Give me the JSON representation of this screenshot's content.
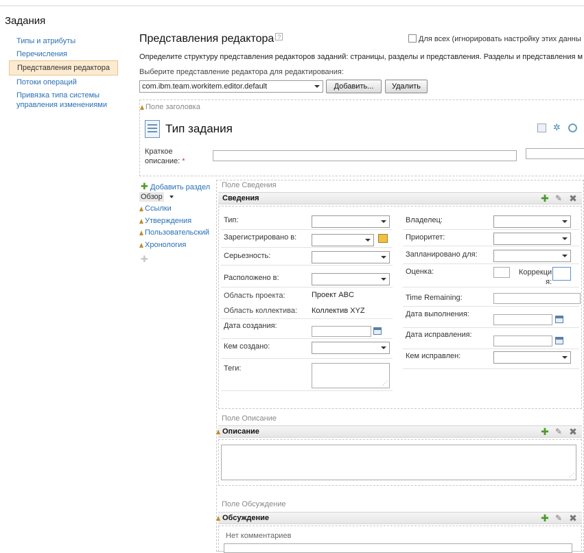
{
  "page": {
    "title": "Задания"
  },
  "nav": {
    "items": [
      {
        "label": "Типы и атрибуты"
      },
      {
        "label": "Перечисления"
      },
      {
        "label": "Представления редактора",
        "active": true
      },
      {
        "label": "Потоки операций"
      },
      {
        "label": "Привязка типа системы",
        "label2": "управления изменениями"
      }
    ]
  },
  "header": {
    "title": "Представления редактора",
    "help_icon": "?",
    "checkbox_label": "Для всех (игнорировать настройку этих данны",
    "description": "Определите структуру представления редакторов заданий: страницы, разделы и представления. Разделы и представления м",
    "choose_label": "Выберите представление редактора для редактирования:",
    "editor_select": "com.ibm.team.workitem.editor.default",
    "add_button": "Добавить...",
    "delete_button": "Удалить"
  },
  "header_area": {
    "label": "Поле заголовка",
    "task_title": "Тип задания",
    "short_desc_label": "Краткое",
    "short_desc_label2": "описание:",
    "required_mark": "*"
  },
  "sections_nav": {
    "add_section": "Добавить раздел",
    "overview": "Обзор",
    "items": [
      {
        "label": "Ссылки"
      },
      {
        "label": "Утверждения"
      },
      {
        "label": "Пользовательский"
      },
      {
        "label": "Хронология"
      }
    ]
  },
  "details": {
    "area_label": "Поле Сведения",
    "title": "Сведения",
    "left_fields": {
      "type": "Тип:",
      "filed_in": "Зарегистрировано в:",
      "severity": "Серьезность:",
      "found_in": "Расположено в:",
      "project_area": "Область проекта:",
      "project_area_value": "Проект ABC",
      "team_area": "Область коллектива:",
      "team_area_value": "Коллектив XYZ",
      "created": "Дата создания:",
      "created_by": "Кем создано:",
      "tags": "Теги:"
    },
    "right_fields": {
      "owner": "Владелец:",
      "priority": "Приоритет:",
      "planned_for": "Запланировано для:",
      "estimate": "Оценка:",
      "correction": "Коррекци",
      "correction2": "я:",
      "time_remaining": "Time Remaining:",
      "due_date": "Дата выполнения:",
      "resolved_date": "Дата исправления:",
      "resolved_by": "Кем исправлен:"
    }
  },
  "description": {
    "area_label": "Поле Описание",
    "title": "Описание"
  },
  "discussion": {
    "area_label": "Поле Обсуждение",
    "title": "Обсуждение",
    "empty": "Нет комментариев"
  }
}
